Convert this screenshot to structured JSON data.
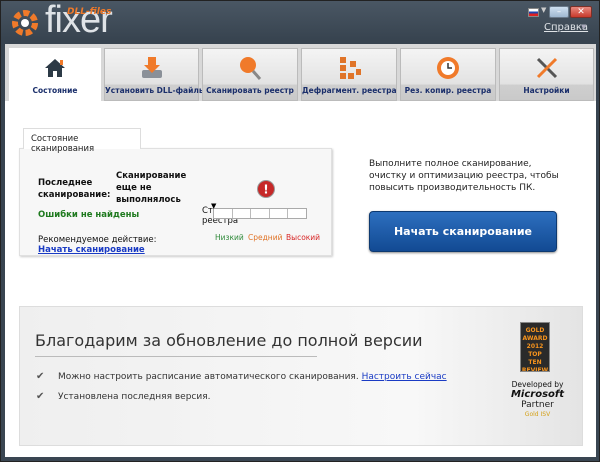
{
  "app": {
    "logo_small": "DLL-files",
    "logo_main": "fixer",
    "help_menu": "Справка"
  },
  "tabs": [
    {
      "label": "Состояние",
      "icon": "home-icon",
      "active": true
    },
    {
      "label": "Установить DLL-файлы",
      "icon": "download-drive-icon"
    },
    {
      "label": "Сканировать реестр",
      "icon": "magnifier-icon"
    },
    {
      "label": "Дефрагмент. реестра",
      "icon": "defrag-blocks-icon"
    },
    {
      "label": "Рез. копир. реестра",
      "icon": "clock-backup-icon"
    },
    {
      "label": "Настройки",
      "icon": "tools-icon"
    }
  ],
  "scan": {
    "tab_label": "Состояние сканирования",
    "last_scan_label": "Последнее сканирование:",
    "last_scan_value": "Сканирование еще не выполнялось",
    "errors": "Ошибки не найдены",
    "recommended_label": "Рекомендуемое действие:",
    "recommended_link": "Начать сканирование",
    "severity_title": "Степень повреждения реестра",
    "severity_low": "Низкий",
    "severity_mid": "Средний",
    "severity_high": "Высокий",
    "severity_level": 0
  },
  "right": {
    "text": "Выполните полное сканирование, очистку и оптимизацию реестра, чтобы повысить производительность ПК.",
    "button": "Начать сканирование"
  },
  "bottom": {
    "title": "Благодарим за обновление до полной версии",
    "item1": "Можно настроить расписание автоматического сканирования.",
    "item1_link": "Настроить сейчас",
    "item2": "Установлена последняя версия.",
    "award": "GOLD AWARD 2012 TOP TEN REVIEWS",
    "ms_developed": "Developed by",
    "ms_name": "Microsoft",
    "ms_partner": "Partner",
    "ms_gold": "Gold ISV"
  },
  "colors": {
    "accent": "#f07a2a",
    "button": "#1d5aa8",
    "green": "#1f7a1f"
  }
}
